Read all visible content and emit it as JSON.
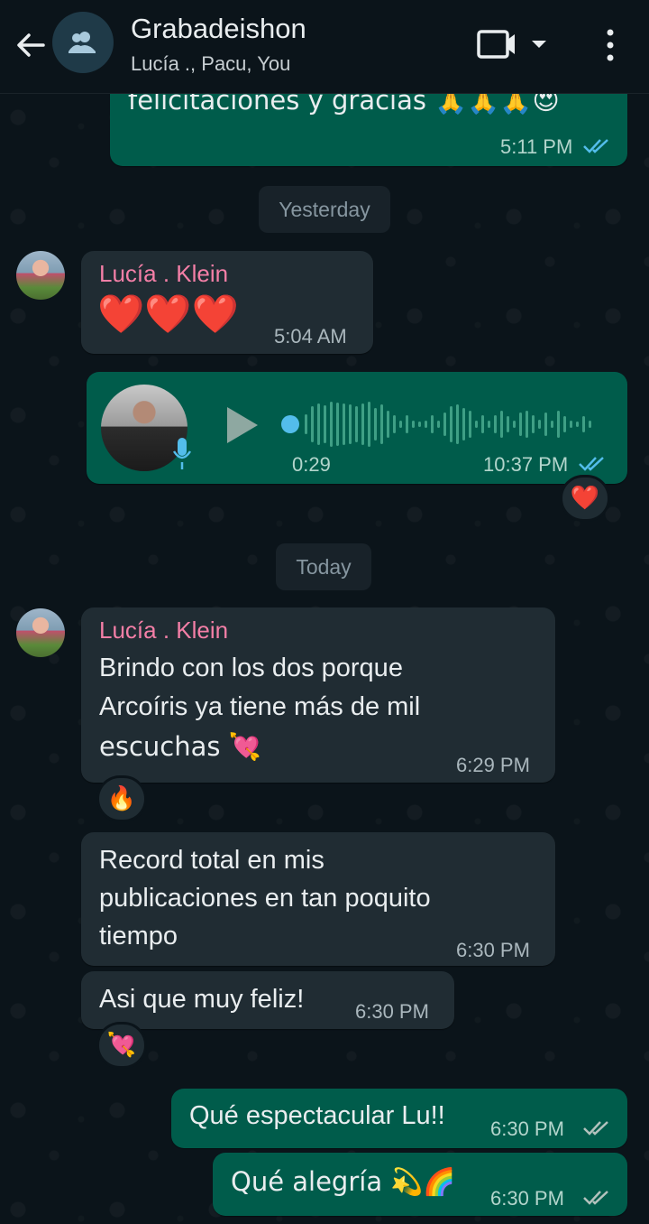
{
  "header": {
    "title": "Grabadeishon",
    "subtitle": "Lucía ., Pacu, You"
  },
  "messages": {
    "m0": {
      "text": "felicitaciones y gracias 🙏🙏🙏😍",
      "time": "5:11 PM"
    },
    "date1": "Yesterday",
    "m1": {
      "sender": "Lucía . Klein",
      "text": "❤️❤️❤️",
      "time": "5:04 AM"
    },
    "m2": {
      "duration": "0:29",
      "time": "10:37 PM",
      "reaction": "❤️"
    },
    "date2": "Today",
    "m3": {
      "sender": "Lucía . Klein",
      "line1": "Brindo con los dos porque",
      "line2": "Arcoíris ya tiene más de mil",
      "line3": "escuchas 💘",
      "time": "6:29 PM",
      "reaction": "🔥"
    },
    "m4": {
      "line1": "Record total en mis",
      "line2": "publicaciones en tan poquito",
      "line3": "tiempo",
      "time": "6:30 PM"
    },
    "m5": {
      "text": "Asi que muy feliz!",
      "time": "6:30 PM",
      "reaction": "💘"
    },
    "m6": {
      "text": "Qué espectacular Lu!!",
      "time": "6:30 PM"
    },
    "m7": {
      "text": "Qué alegría 💫🌈",
      "time": "6:30 PM"
    }
  },
  "colors": {
    "outgoing_bubble": "#005c4b",
    "incoming_bubble": "#202c33",
    "sender_name": "#f47fa7",
    "read_ticks": "#53bdeb"
  }
}
